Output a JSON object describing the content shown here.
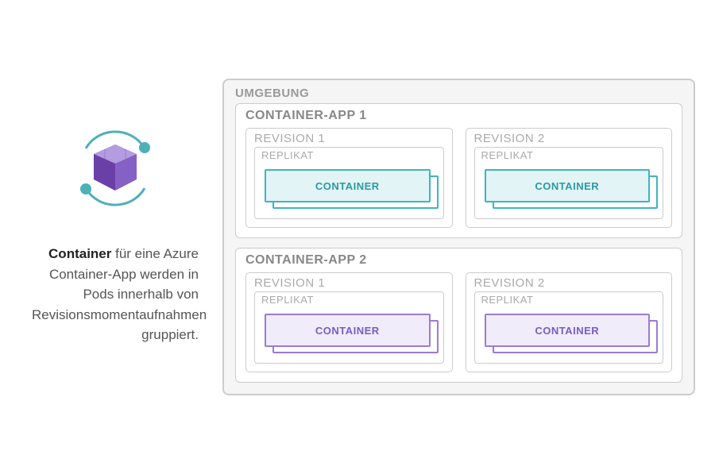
{
  "description": {
    "bold": "Container",
    "rest": " für eine Azure Container-App werden in Pods innerhalb von Revisionsmomentaufnahmen gruppiert."
  },
  "env": {
    "title": "UMGEBUNG",
    "apps": [
      {
        "title": "CONTAINER-APP 1",
        "color": "teal",
        "revisions": [
          {
            "title": "REVISION 1",
            "replica": "REPLIKAT",
            "container": "CONTAINER"
          },
          {
            "title": "REVISION 2",
            "replica": "REPLIKAT",
            "container": "CONTAINER"
          }
        ]
      },
      {
        "title": "CONTAINER-APP 2",
        "color": "purple",
        "revisions": [
          {
            "title": "REVISION 1",
            "replica": "REPLIKAT",
            "container": "CONTAINER"
          },
          {
            "title": "REVISION 2",
            "replica": "REPLIKAT",
            "container": "CONTAINER"
          }
        ]
      }
    ]
  }
}
